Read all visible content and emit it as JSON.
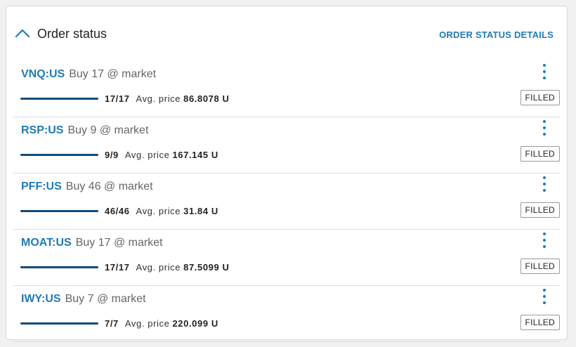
{
  "panel": {
    "title": "Order status",
    "details_link": "ORDER STATUS DETAILS"
  },
  "colors": {
    "link": "#1f7bb6",
    "progress": "#0f4c7a"
  },
  "orders": [
    {
      "symbol": "VNQ:US",
      "description": "Buy 17 @ market",
      "filled": "17/17",
      "fill_fraction": 1.0,
      "avg_label": "Avg. price",
      "avg_price": "86.8078 U",
      "status": "FILLED"
    },
    {
      "symbol": "RSP:US",
      "description": "Buy 9 @ market",
      "filled": "9/9",
      "fill_fraction": 1.0,
      "avg_label": "Avg. price",
      "avg_price": "167.145 U",
      "status": "FILLED"
    },
    {
      "symbol": "PFF:US",
      "description": "Buy 46 @ market",
      "filled": "46/46",
      "fill_fraction": 1.0,
      "avg_label": "Avg. price",
      "avg_price": "31.84 U",
      "status": "FILLED"
    },
    {
      "symbol": "MOAT:US",
      "description": "Buy 17 @ market",
      "filled": "17/17",
      "fill_fraction": 1.0,
      "avg_label": "Avg. price",
      "avg_price": "87.5099 U",
      "status": "FILLED"
    },
    {
      "symbol": "IWY:US",
      "description": "Buy 7 @ market",
      "filled": "7/7",
      "fill_fraction": 1.0,
      "avg_label": "Avg. price",
      "avg_price": "220.099 U",
      "status": "FILLED"
    }
  ],
  "icons": {
    "collapse": "chevron-up-icon",
    "row_menu": "more-vertical-icon"
  }
}
